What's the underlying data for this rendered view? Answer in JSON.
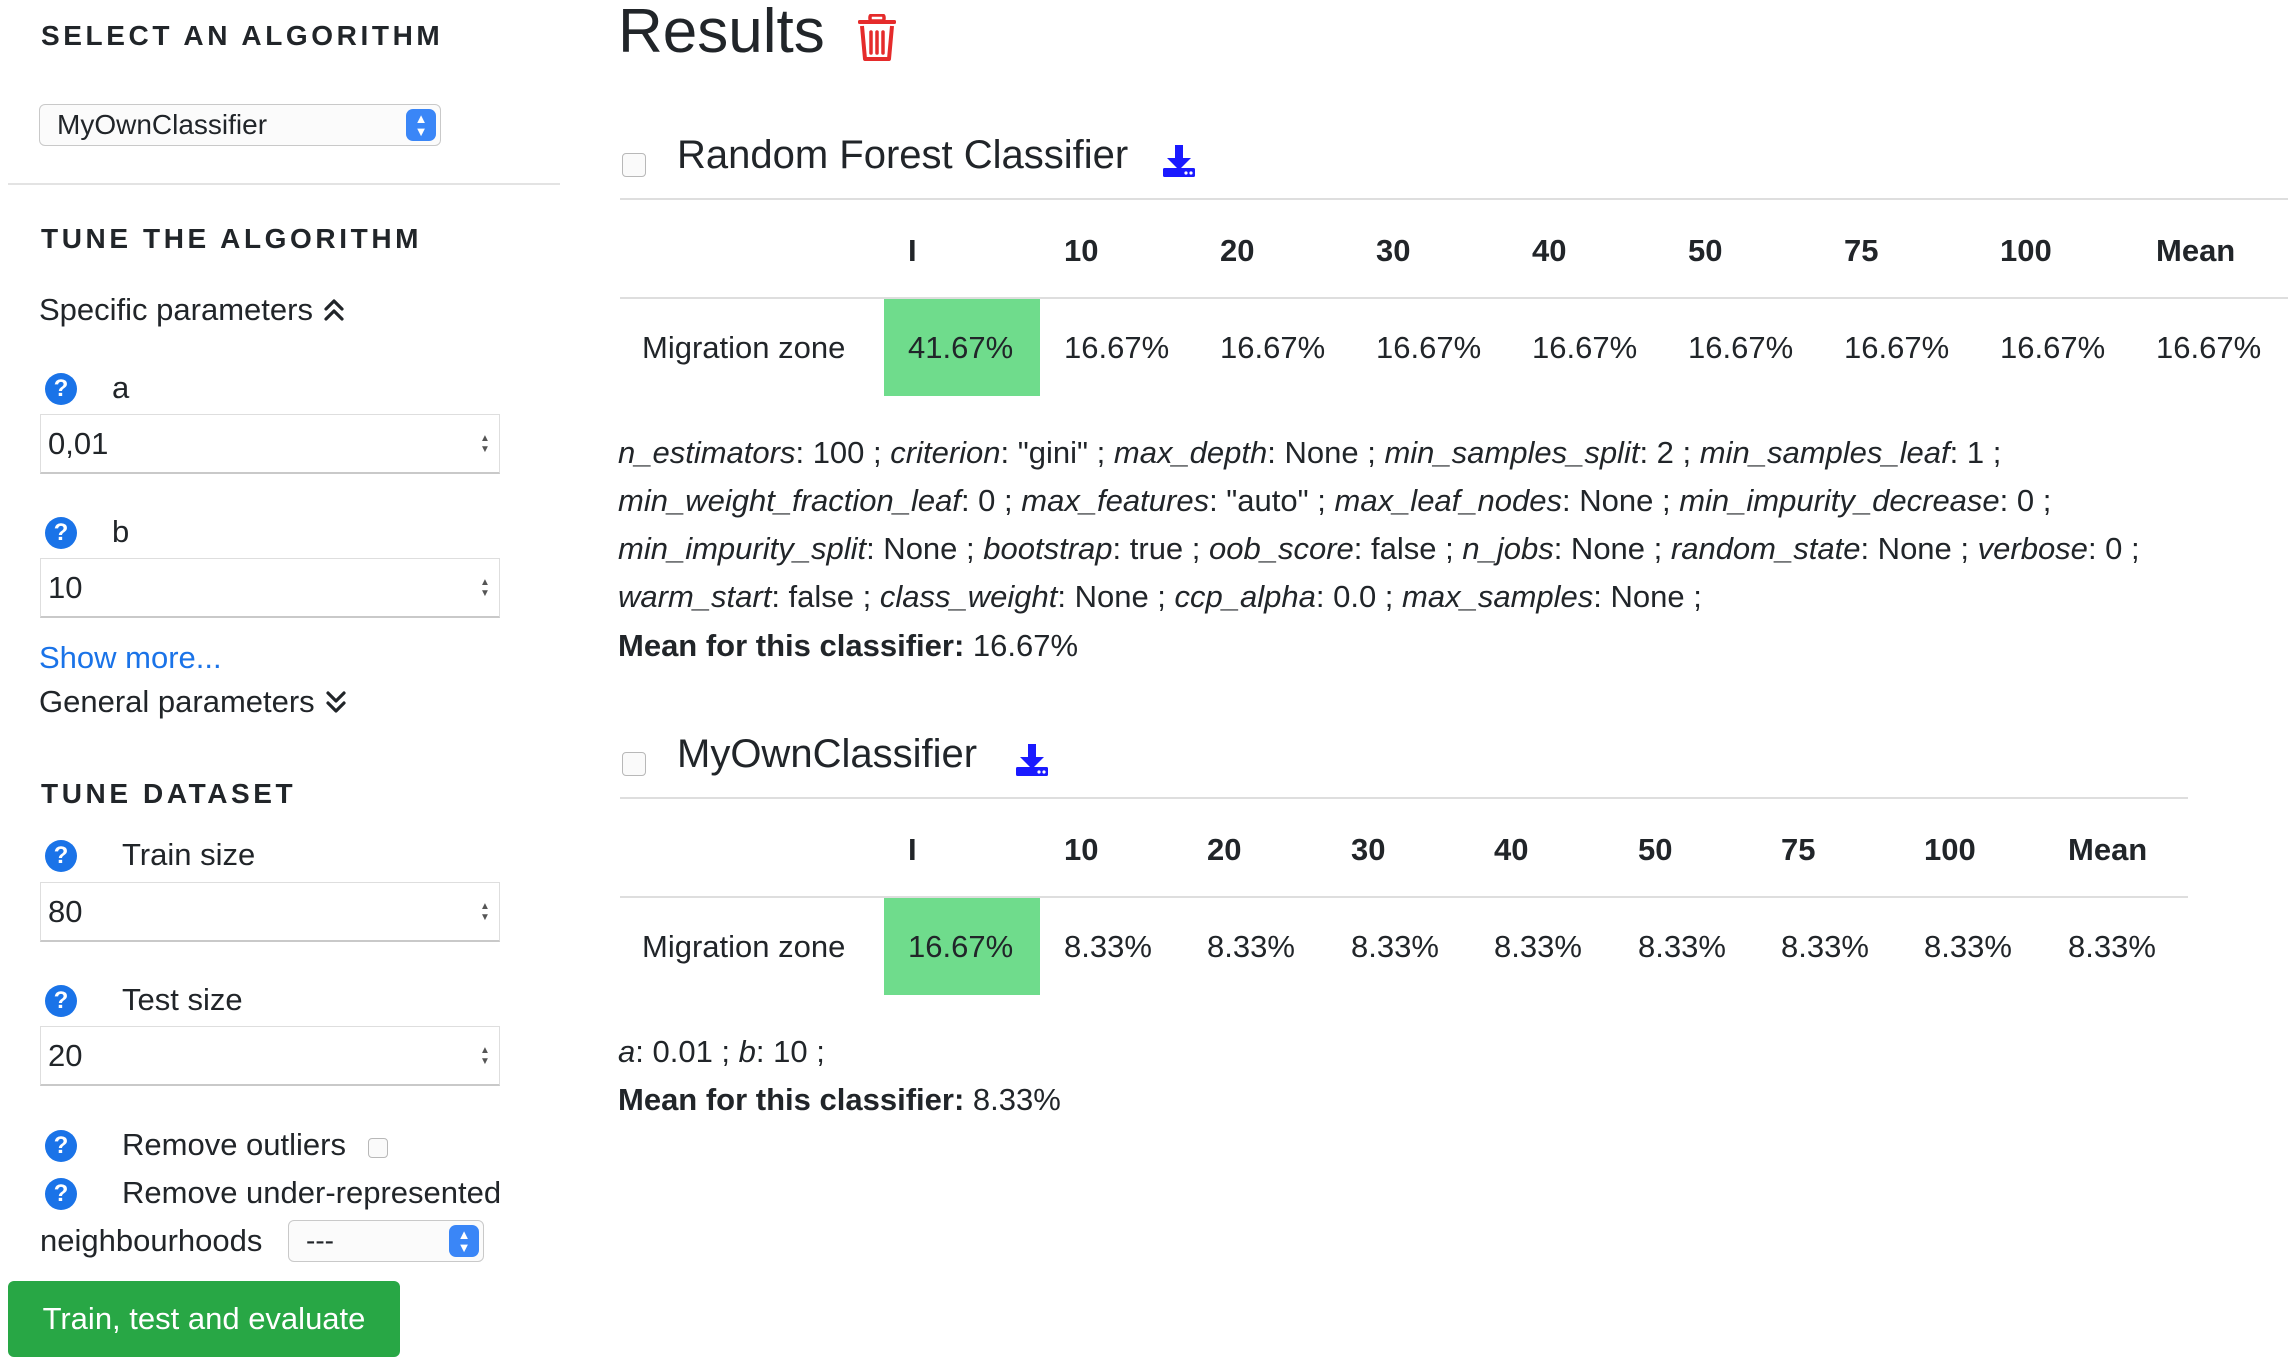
{
  "sidebar": {
    "select_title": "SELECT AN ALGORITHM",
    "algorithm_selected": "MyOwnClassifier",
    "tune_title": "TUNE THE ALGORITHM",
    "specific_params_label": "Specific parameters",
    "param_a_label": "a",
    "param_a_value": "0,01",
    "param_b_label": "b",
    "param_b_value": "10",
    "show_more_label": "Show more...",
    "general_params_label": "General parameters",
    "dataset_title": "TUNE DATASET",
    "train_size_label": "Train size",
    "train_size_value": "80",
    "test_size_label": "Test size",
    "test_size_value": "20",
    "remove_outliers_label": "Remove outliers",
    "remove_underrep_label_1": "Remove under-represented",
    "remove_underrep_label_2": "neighbourhoods",
    "neighbourhoods_selected": "---",
    "train_button_label": "Train, test and evaluate"
  },
  "results": {
    "title": "Results",
    "classifiers": [
      {
        "name": "Random Forest Classifier",
        "headers": [
          "I",
          "10",
          "20",
          "30",
          "40",
          "50",
          "75",
          "100",
          "Mean"
        ],
        "row_label": "Migration zone",
        "values": [
          "41.67%",
          "16.67%",
          "16.67%",
          "16.67%",
          "16.67%",
          "16.67%",
          "16.67%",
          "16.67%",
          "16.67%"
        ],
        "params_lines": [
          [
            [
              "n_estimators",
              ": 100 ; "
            ],
            [
              "criterion",
              ": \"gini\" ; "
            ],
            [
              "max_depth",
              ": None ; "
            ],
            [
              "min_samples_split",
              ": 2 ; "
            ],
            [
              "min_samples_leaf",
              ": 1 ;"
            ]
          ],
          [
            [
              "min_weight_fraction_leaf",
              ": 0 ; "
            ],
            [
              "max_features",
              ": \"auto\" ; "
            ],
            [
              "max_leaf_nodes",
              ": None ; "
            ],
            [
              "min_impurity_decrease",
              ": 0 ;"
            ]
          ],
          [
            [
              "min_impurity_split",
              ": None ; "
            ],
            [
              "bootstrap",
              ": true ; "
            ],
            [
              "oob_score",
              ": false ; "
            ],
            [
              "n_jobs",
              ": None ; "
            ],
            [
              "random_state",
              ": None ; "
            ],
            [
              "verbose",
              ": 0 ;"
            ]
          ],
          [
            [
              "warm_start",
              ": false ; "
            ],
            [
              "class_weight",
              ": None ; "
            ],
            [
              "ccp_alpha",
              ": 0.0 ; "
            ],
            [
              "max_samples",
              ": None ;"
            ]
          ]
        ],
        "mean_label": "Mean for this classifier:",
        "mean_value": " 16.67%"
      },
      {
        "name": "MyOwnClassifier",
        "headers": [
          "I",
          "10",
          "20",
          "30",
          "40",
          "50",
          "75",
          "100",
          "Mean"
        ],
        "row_label": "Migration zone",
        "values": [
          "16.67%",
          "8.33%",
          "8.33%",
          "8.33%",
          "8.33%",
          "8.33%",
          "8.33%",
          "8.33%",
          "8.33%"
        ],
        "params_lines": [
          [
            [
              "a",
              ": 0.01 ; "
            ],
            [
              "b",
              ": 10 ;"
            ]
          ]
        ],
        "mean_label": "Mean for this classifier:",
        "mean_value": " 8.33%"
      }
    ]
  },
  "colors": {
    "highlight": "#6fdc8c",
    "accent": "#1a73e8",
    "button": "#28a745",
    "trash": "#e52b2b"
  }
}
